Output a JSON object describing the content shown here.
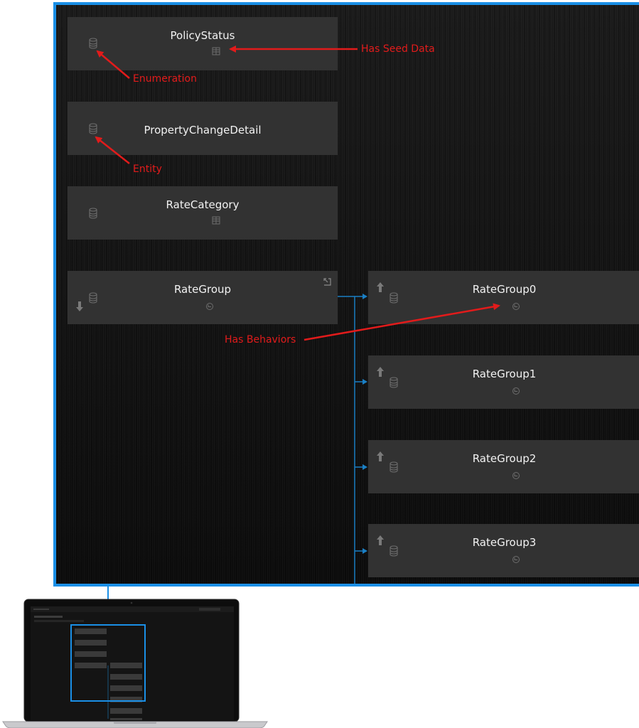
{
  "nodes": [
    {
      "id": "policystatus",
      "name": "PolicyStatus"
    },
    {
      "id": "propertychangedetail",
      "name": "PropertyChangeDetail"
    },
    {
      "id": "ratecategory",
      "name": "RateCategory"
    },
    {
      "id": "rategroup",
      "name": "RateGroup"
    },
    {
      "id": "rategroup0",
      "name": "RateGroup0"
    },
    {
      "id": "rategroup1",
      "name": "RateGroup1"
    },
    {
      "id": "rategroup2",
      "name": "RateGroup2"
    },
    {
      "id": "rategroup3",
      "name": "RateGroup3"
    }
  ],
  "annotations": {
    "enumeration": "Enumeration",
    "seed_data": "Has Seed Data",
    "entity": "Entity",
    "behaviors": "Has Behaviors"
  },
  "icons": {
    "type": "database-icon",
    "seed": "seed-data-icon",
    "behavior": "behavior-icon",
    "inherit_down": "arrow-down-icon",
    "inherit_up": "arrow-up-icon",
    "expand": "expand-icon"
  },
  "colors": {
    "highlight": "#1a8fe6",
    "annotation": "#e21b1b",
    "connector": "#1a7fc4",
    "node": "#323232",
    "node_text": "#f2f2f2"
  }
}
